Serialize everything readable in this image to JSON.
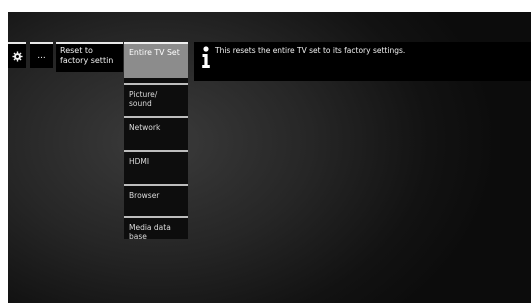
{
  "icons": {
    "gear": "gear-icon",
    "info": "info-icon"
  },
  "colors": {
    "tile_background": "#000000",
    "selected_item": "#8c8c8c",
    "text": "#f2f2f2"
  },
  "breadcrumb": {
    "more_label": "...",
    "reset_label_line1": "Reset to",
    "reset_label_line2": "factory settin"
  },
  "submenu": {
    "items": [
      {
        "line1": "Entire TV Set",
        "line2": "",
        "selected": true
      },
      {
        "line1": "Picture/",
        "line2": "sound",
        "selected": false
      },
      {
        "line1": "Network",
        "line2": "",
        "selected": false
      },
      {
        "line1": "HDMI",
        "line2": "",
        "selected": false
      },
      {
        "line1": "Browser",
        "line2": "",
        "selected": false
      },
      {
        "line1": "Media data",
        "line2": "base",
        "selected": false
      }
    ]
  },
  "info": {
    "text": "This resets the entire TV set to its factory settings."
  }
}
